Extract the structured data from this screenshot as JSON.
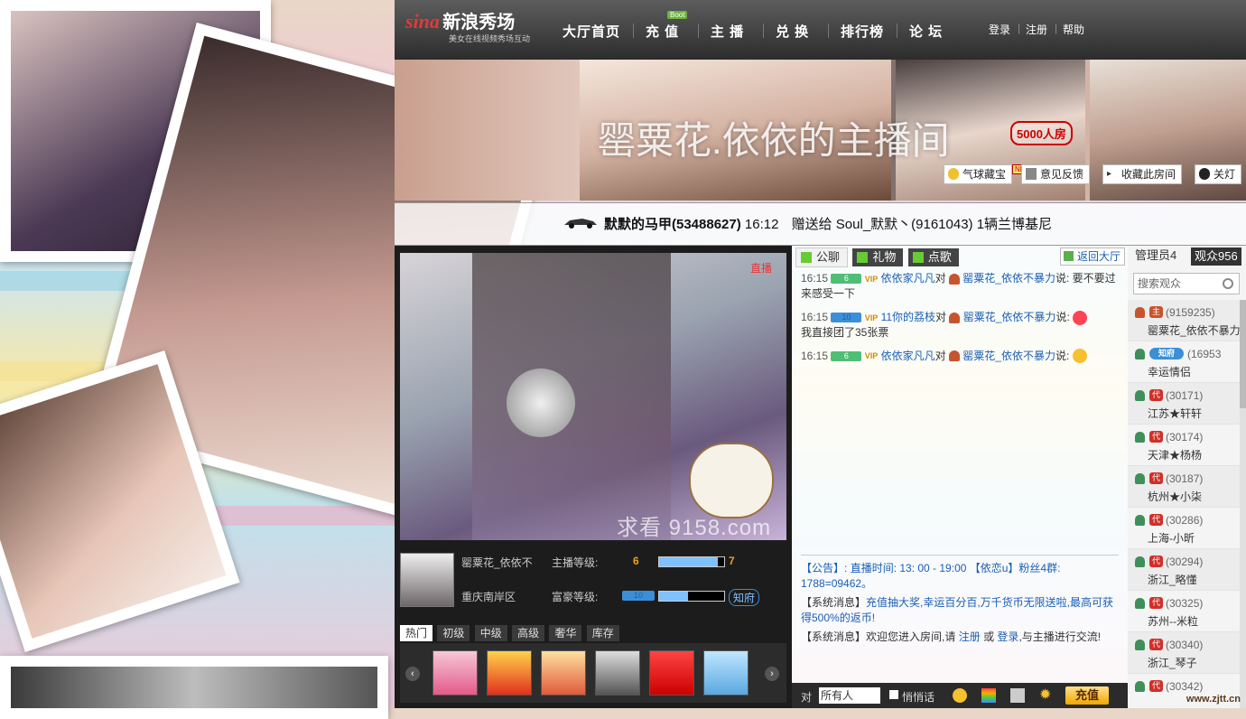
{
  "logo": {
    "brand": "sina",
    "name": "新浪秀场",
    "tagline": "美女在线视频秀场互动"
  },
  "nav": {
    "items": [
      "大厅首页",
      "充 值",
      "主 播",
      "兑 换",
      "排行榜",
      "论 坛"
    ],
    "recharge_tag": "Boot",
    "links": [
      "登录",
      "注册",
      "帮助"
    ]
  },
  "banner": {
    "room_title": "罂粟花.依依的主播间",
    "capacity": "5000人房",
    "buttons": [
      "气球藏宝",
      "意见反馈",
      "收藏此房间",
      "关灯"
    ],
    "new_tag": "NEW"
  },
  "ticker": {
    "sender": "默默的马甲(53488627)",
    "time": "16:12",
    "message": "赠送给 Soul_默默丶(9161043) 1辆兰博基尼"
  },
  "video": {
    "live_label": "直播",
    "watermark": "求看 9158.com"
  },
  "host": {
    "name": "罂粟花_依依不",
    "location": "重庆南岸区",
    "anchor_level_label": "主播等级:",
    "anchor_level_from": "6",
    "anchor_level_to": "7",
    "anchor_progress": 0.9,
    "wealth_level_label": "富豪等级:",
    "wealth_level": "10",
    "wealth_progress": 0.45,
    "wealth_title": "知府"
  },
  "gift_tabs": [
    "热门",
    "初级",
    "中级",
    "高级",
    "奢华",
    "库存"
  ],
  "gift_icons": [
    "doll-gift-icon",
    "giftbox-icon",
    "couple-gift-icon",
    "diamond-icon",
    "love-letter-icon",
    "2012-gift-icon"
  ],
  "chat": {
    "tabs": [
      "公聊",
      "礼物",
      "点歌"
    ],
    "messages": [
      {
        "time": "16:15",
        "level": "6",
        "vip": "VIP",
        "from": "依依家凡凡",
        "to_word": "对",
        "to": "罂粟花_依依不暴力",
        "said": "说:",
        "text": "要不要过来感受一下"
      },
      {
        "time": "16:15",
        "level": "10",
        "vip": "VIP",
        "from": "11你的荔枝",
        "to_word": "对",
        "to": "罂粟花_依依不暴力",
        "said": "说:",
        "text": "我直接团了35张票"
      },
      {
        "time": "16:15",
        "level": "6",
        "vip": "VIP",
        "from": "依依家凡凡",
        "to_word": "对",
        "to": "罂粟花_依依不暴力",
        "said": "说:",
        "text": ""
      }
    ],
    "notice": {
      "label": "【公告】:",
      "text": "直播时间: 13: 00 - 19:00 【依恋u】粉丝4群: 1788=09462。"
    },
    "system1": {
      "label": "【系统消息】",
      "link": "充值抽大奖,幸运百分百,万千货币无限送啦,最高可获得500%的返币!"
    },
    "system2": {
      "label": "【系统消息】",
      "pre": "欢迎您进入房间,请",
      "reg": "注册",
      "or": "或",
      "login": "登录",
      "post": ",与主播进行交流!"
    }
  },
  "input": {
    "to_label": "对",
    "target": "所有人",
    "whisper": "悄悄话",
    "charge": "充值"
  },
  "users": {
    "back_label": "返回大厅",
    "tab_admin": "管理员4",
    "tab_viewers": "观众956",
    "search_placeholder": "搜索观众",
    "list": [
      {
        "id": "(9159235)",
        "name": "罂粟花_依依不暴力",
        "badge": "主"
      },
      {
        "id": "(16953",
        "name": "幸运情侣",
        "badge": "知府"
      },
      {
        "id": "(30171)",
        "name": "江苏★轩轩",
        "badge": "代"
      },
      {
        "id": "(30174)",
        "name": "天津★杨杨",
        "badge": "代"
      },
      {
        "id": "(30187)",
        "name": "杭州★小柒",
        "badge": "代"
      },
      {
        "id": "(30286)",
        "name": "上海-小昕",
        "badge": "代"
      },
      {
        "id": "(30294)",
        "name": "浙江_略懂",
        "badge": "代"
      },
      {
        "id": "(30325)",
        "name": "苏州--米粒",
        "badge": "代"
      },
      {
        "id": "(30340)",
        "name": "浙江_琴子",
        "badge": "代"
      },
      {
        "id": "(30342)",
        "name": "",
        "badge": "代"
      }
    ]
  },
  "site_mark": "www.zjtt.cn",
  "colors": {
    "accent": "#1a5fb4",
    "nav_bg": "#333333",
    "alert": "#e33333"
  }
}
